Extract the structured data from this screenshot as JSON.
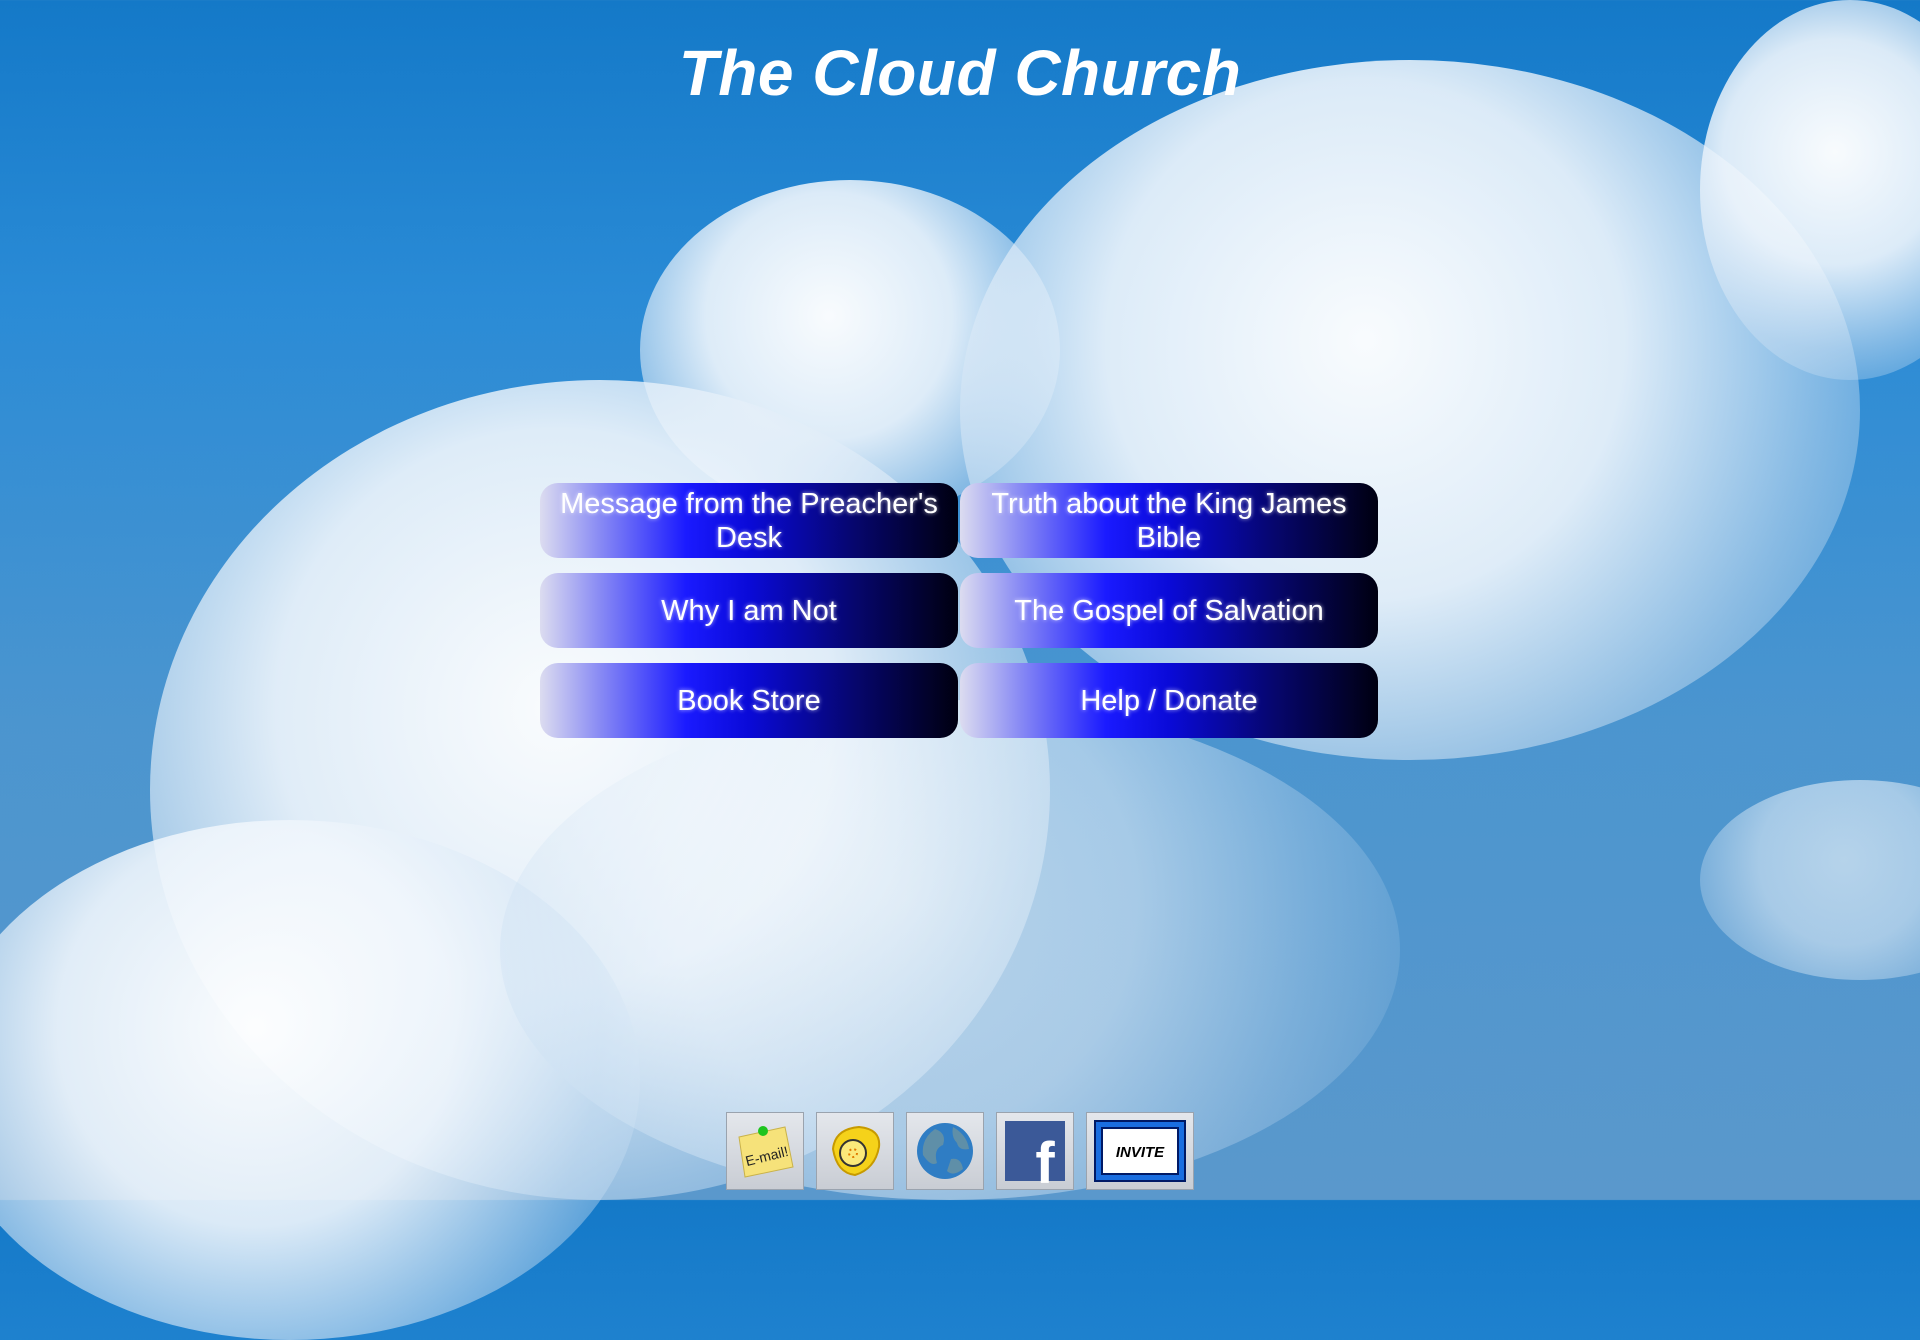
{
  "header": {
    "title": "The Cloud Church"
  },
  "menu": {
    "items": [
      {
        "label": "Message from the Preacher's Desk"
      },
      {
        "label": "Truth about the King James Bible"
      },
      {
        "label": "Why I am Not"
      },
      {
        "label": "The Gospel of Salvation"
      },
      {
        "label": "Book Store"
      },
      {
        "label": "Help / Donate"
      }
    ]
  },
  "footer": {
    "icons": [
      {
        "name": "email-note-icon",
        "label": "E-mail!"
      },
      {
        "name": "telephone-icon",
        "label": ""
      },
      {
        "name": "globe-icon",
        "label": ""
      },
      {
        "name": "facebook-icon",
        "label": "f"
      },
      {
        "name": "invite-icon",
        "label": "INVITE"
      }
    ]
  },
  "colors": {
    "sky": "#1e82cf",
    "button_mid": "#1a1aff",
    "button_dark": "#000010",
    "facebook": "#3b5998"
  }
}
